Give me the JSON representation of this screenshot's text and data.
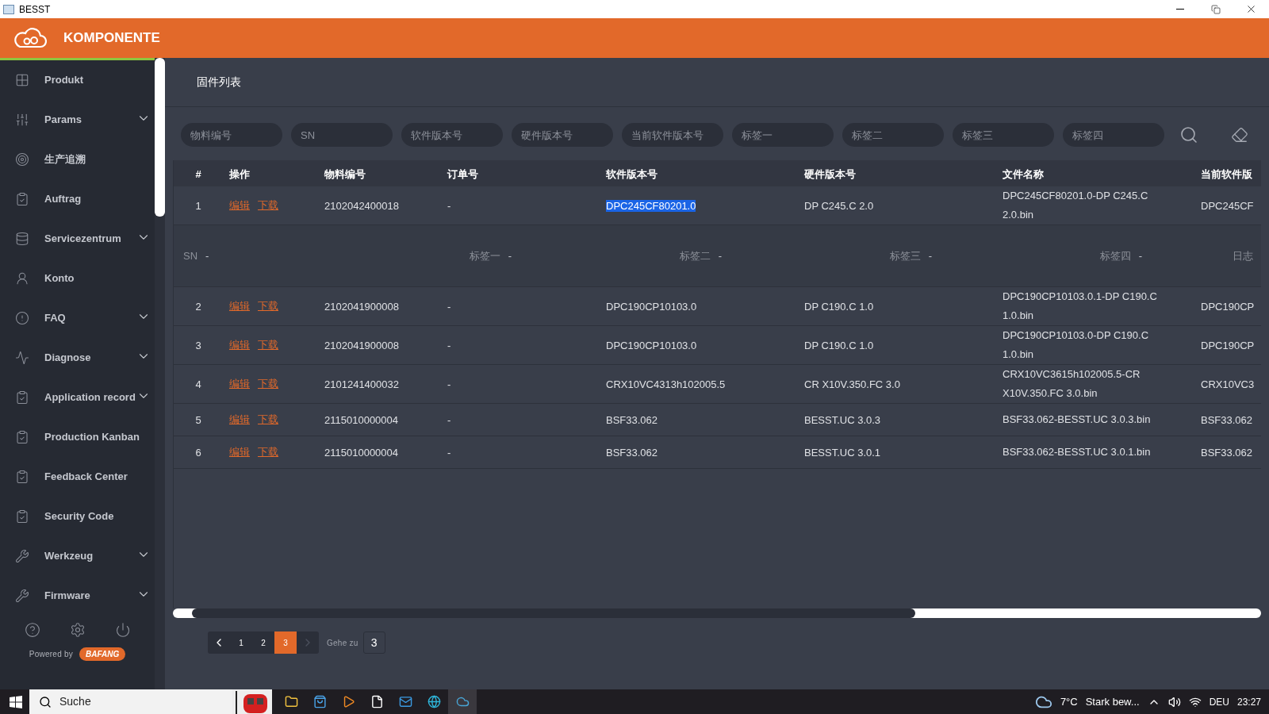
{
  "window": {
    "title": "BESST"
  },
  "header": {
    "title": "KOMPONENTE"
  },
  "sidebar": {
    "items": [
      {
        "label": "Produkt",
        "expandable": false
      },
      {
        "label": "Params",
        "expandable": true
      },
      {
        "label": "生产追溯",
        "expandable": false
      },
      {
        "label": "Auftrag",
        "expandable": false
      },
      {
        "label": "Servicezentrum",
        "expandable": true
      },
      {
        "label": "Konto",
        "expandable": false
      },
      {
        "label": "FAQ",
        "expandable": true
      },
      {
        "label": "Diagnose",
        "expandable": true
      },
      {
        "label": "Application record",
        "expandable": true
      },
      {
        "label": "Production Kanban",
        "expandable": false
      },
      {
        "label": "Feedback Center",
        "expandable": false
      },
      {
        "label": "Security Code",
        "expandable": false
      },
      {
        "label": "Werkzeug",
        "expandable": true
      },
      {
        "label": "Firmware",
        "expandable": true
      }
    ],
    "powered_by": "Powered by",
    "brand": "BAFANG"
  },
  "page": {
    "title": "固件列表"
  },
  "filters": [
    {
      "placeholder": "物料编号"
    },
    {
      "placeholder": "SN"
    },
    {
      "placeholder": "软件版本号"
    },
    {
      "placeholder": "硬件版本号"
    },
    {
      "placeholder": "当前软件版本号"
    },
    {
      "placeholder": "标签一"
    },
    {
      "placeholder": "标签二"
    },
    {
      "placeholder": "标签三"
    },
    {
      "placeholder": "标签四"
    }
  ],
  "table": {
    "columns": [
      "#",
      "操作",
      "物料编号",
      "订单号",
      "软件版本号",
      "硬件版本号",
      "文件名称",
      "当前软件版"
    ],
    "rows": [
      {
        "cells": [
          "1",
          "",
          "2102042400018",
          "-",
          "DPC245CF80201.0",
          "DP C245.C 2.0",
          "DPC245CF80201.0-DP C245.C 2.0.bin",
          "DPC245CF"
        ],
        "actions": [
          "编辑",
          "下载"
        ],
        "highlighted": true,
        "details": [
          {
            "label": "SN",
            "value": "-"
          },
          {
            "label": "标签一",
            "value": "-"
          },
          {
            "label": "标签二",
            "value": "-"
          },
          {
            "label": "标签三",
            "value": "-"
          },
          {
            "label": "标签四",
            "value": "-"
          },
          {
            "label": "日志"
          }
        ]
      },
      {
        "cells": [
          "2",
          "",
          "2102041900008",
          "-",
          "DPC190CP10103.0",
          "DP C190.C 1.0",
          "DPC190CP10103.0.1-DP C190.C 1.0.bin",
          "DPC190CP"
        ],
        "actions": [
          "编辑",
          "下载"
        ],
        "highlighted": false
      },
      {
        "cells": [
          "3",
          "",
          "2102041900008",
          "-",
          "DPC190CP10103.0",
          "DP C190.C 1.0",
          "DPC190CP10103.0-DP C190.C 1.0.bin",
          "DPC190CP"
        ],
        "actions": [
          "编辑",
          "下载"
        ],
        "highlighted": false
      },
      {
        "cells": [
          "4",
          "",
          "2101241400032",
          "-",
          "CRX10VC4313h102005.5",
          "CR X10V.350.FC 3.0",
          "CRX10VC3615h102005.5-CR X10V.350.FC 3.0.bin",
          "CRX10VC3"
        ],
        "actions": [
          "编辑",
          "下载"
        ],
        "highlighted": false
      },
      {
        "cells": [
          "5",
          "",
          "2115010000004",
          "-",
          "BSF33.062",
          "BESST.UC 3.0.3",
          "BSF33.062-BESST.UC 3.0.3.bin",
          "BSF33.062"
        ],
        "actions": [
          "编辑",
          "下载"
        ],
        "highlighted": false
      },
      {
        "cells": [
          "6",
          "",
          "2115010000004",
          "-",
          "BSF33.062",
          "BESST.UC 3.0.1",
          "BSF33.062-BESST.UC 3.0.1.bin",
          "BSF33.062"
        ],
        "actions": [
          "编辑",
          "下载"
        ],
        "highlighted": false
      }
    ]
  },
  "pagination": {
    "pages": [
      {
        "label": "1",
        "selected": false
      },
      {
        "label": "2",
        "selected": false
      },
      {
        "label": "3",
        "selected": true
      }
    ],
    "next_disabled": true,
    "goto_label": "Gehe zu",
    "goto_value": "3"
  },
  "taskbar": {
    "search_placeholder": "Suche",
    "weather": "7°C",
    "weather_text": "Stark bew...",
    "language": "DEU",
    "time": "23:27"
  }
}
